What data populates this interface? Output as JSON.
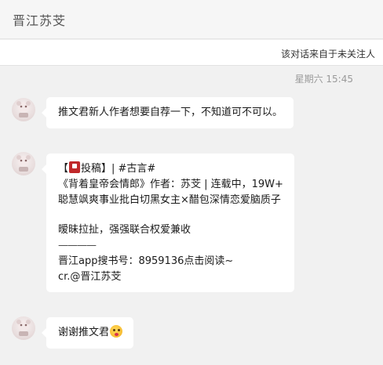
{
  "header": {
    "title": "晋江苏芠"
  },
  "notice": {
    "text": "该对话来自于未关注人"
  },
  "timestamp": "星期六 15:45",
  "messages": [
    {
      "lines": [
        "推文君新人作者想要自荐一下，不知道可不可以。"
      ]
    },
    {
      "tag_prefix": "【",
      "tag_suffix": "投稿】| #古言#",
      "lines": [
        "《背着皇帝会情郎》作者：苏芠 | 连载中，19W+",
        "聪慧飒爽事业批白切黑女主×醋包深情恋爱脑质子"
      ],
      "line_after_gap": "暧昧拉扯，强强联合权爱兼收",
      "separator": "————",
      "tail_lines": [
        "晋江app搜书号：8959136点击阅读~",
        "cr.@晋江苏芠"
      ]
    },
    {
      "text": "谢谢推文君"
    }
  ],
  "icons": {
    "tag": "red-tag-icon",
    "emoji": "kiss-emoji-icon",
    "avatar": "user-avatar"
  }
}
